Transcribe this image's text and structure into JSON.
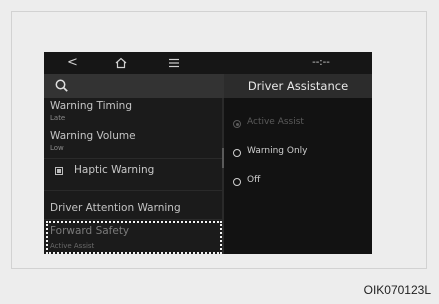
{
  "topbar": {
    "back_glyph": "<",
    "home_icon": "home-icon",
    "menu_icon": "menu-icon",
    "clock": "--:--"
  },
  "header": {
    "search_icon": "search-icon",
    "title": "Driver Assistance"
  },
  "left_menu": {
    "items": [
      {
        "label": "Warning Timing",
        "value": "Late"
      },
      {
        "label": "Warning Volume",
        "value": "Low"
      },
      {
        "label": "Haptic Warning",
        "checked": true
      },
      {
        "label": "Driver Attention Warning"
      },
      {
        "label": "Forward Safety",
        "value": "Active Assist",
        "highlighted": true
      }
    ]
  },
  "right_options": {
    "options": [
      {
        "label": "Active Assist",
        "selected": true,
        "enabled": false
      },
      {
        "label": "Warning Only",
        "selected": false,
        "enabled": true
      },
      {
        "label": "Off",
        "selected": false,
        "enabled": true
      }
    ]
  },
  "figure_code": "OIK070123L"
}
